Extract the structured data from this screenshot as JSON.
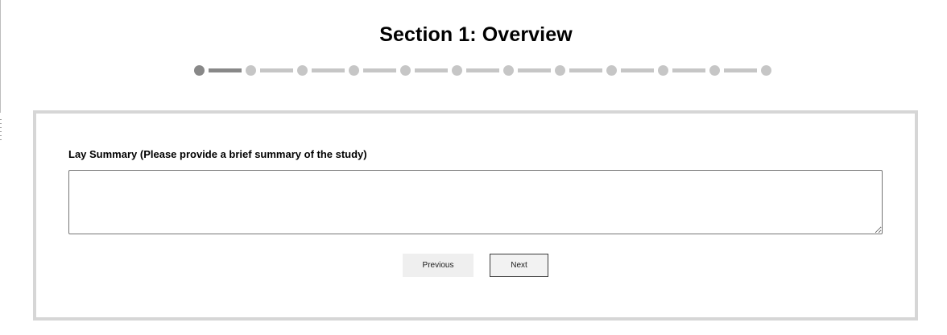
{
  "page": {
    "title": "Section 1: Overview"
  },
  "progress": {
    "total_steps": 12,
    "current_step": 1,
    "active_color": "#888888",
    "inactive_color": "#c6c6c6"
  },
  "form": {
    "lay_summary": {
      "label": "Lay Summary (Please provide a brief summary of the study)",
      "value": ""
    },
    "buttons": {
      "previous_label": "Previous",
      "next_label": "Next"
    }
  },
  "colors": {
    "card_border": "#d6d6d6",
    "input_border": "#767676",
    "button_background": "#efefef"
  }
}
